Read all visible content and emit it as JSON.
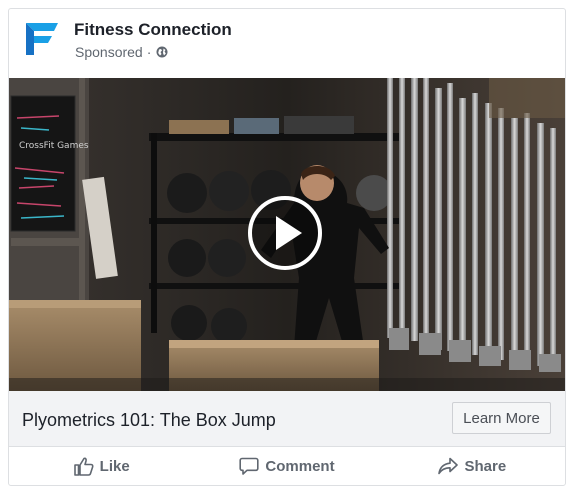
{
  "post": {
    "page_name": "Fitness Connection",
    "sponsored_label": "Sponsored",
    "separator": "·",
    "logo_icon": "fitness-connection-f-logo",
    "logo_colors": [
      "#1aa0e6",
      "#1771c4"
    ]
  },
  "media": {
    "type": "video",
    "play_icon": "play-icon",
    "chalkboard_text": "CrossFit Games"
  },
  "ad": {
    "headline": "Plyometrics 101: The Box Jump",
    "cta_label": "Learn More"
  },
  "actions": [
    {
      "label": "Like",
      "icon": "thumbs-up-icon"
    },
    {
      "label": "Comment",
      "icon": "comment-icon"
    },
    {
      "label": "Share",
      "icon": "share-icon"
    }
  ]
}
